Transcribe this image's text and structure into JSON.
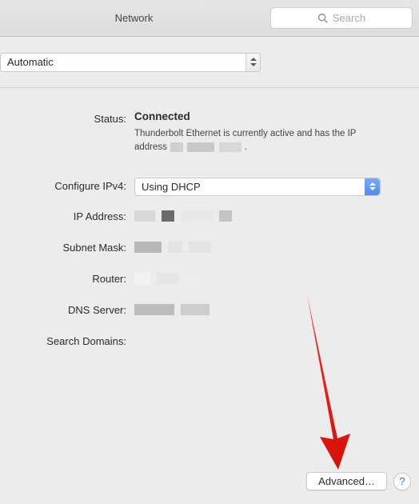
{
  "header": {
    "title": "Network",
    "search_placeholder": "Search"
  },
  "location": {
    "selected": "Automatic"
  },
  "status": {
    "label": "Status:",
    "value": "Connected",
    "description_prefix": "Thunderbolt Ethernet is currently active and has the IP address",
    "description_suffix": "."
  },
  "fields": {
    "configure_ipv4": {
      "label": "Configure IPv4:",
      "value": "Using DHCP"
    },
    "ip_address": {
      "label": "IP Address:"
    },
    "subnet_mask": {
      "label": "Subnet Mask:"
    },
    "router": {
      "label": "Router:"
    },
    "dns_server": {
      "label": "DNS Server:"
    },
    "search_domains": {
      "label": "Search Domains:"
    }
  },
  "footer": {
    "advanced_label": "Advanced…",
    "help_label": "?"
  }
}
